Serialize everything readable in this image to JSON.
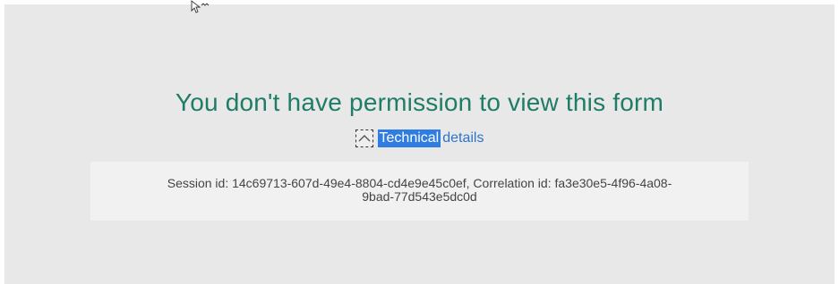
{
  "error": {
    "title": "You don't have permission to view this form"
  },
  "technical_details": {
    "toggle_highlight": "Technical",
    "toggle_rest": "details",
    "toggle_icon": "chevron-up-icon",
    "line1": "Session id: 14c69713-607d-49e4-8804-cd4e9e45c0ef, Correlation id: fa3e30e5-4f96-4a08-",
    "line2": "9bad-77d543e5dc0d"
  },
  "colors": {
    "title": "#1e7c67",
    "link": "#2c74c9",
    "selection": "#2f7de0",
    "background": "#e9e8e8"
  }
}
